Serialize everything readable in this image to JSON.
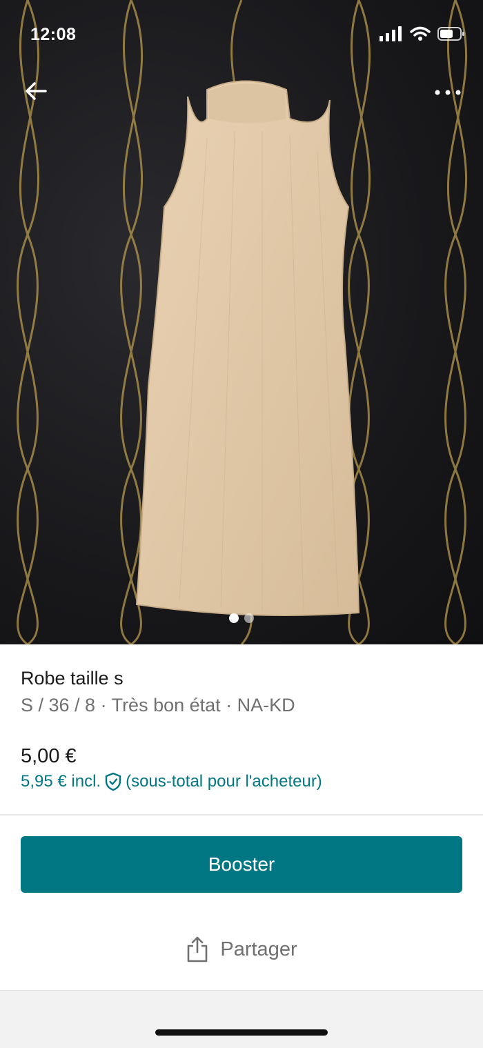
{
  "status_bar": {
    "time": "12:08"
  },
  "photo": {
    "current_index": 1,
    "total": 2
  },
  "item": {
    "title": "Robe taille s",
    "details": "S / 36 / 8 · Très bon état · NA-KD",
    "price": "5,00 €",
    "price_incl_amount": "5,95 € incl.",
    "price_incl_note": "(sous-total pour l'acheteur)"
  },
  "actions": {
    "booster_label": "Booster",
    "share_label": "Partager"
  },
  "colors": {
    "accent": "#007782",
    "text_primary": "#1a1a1a",
    "text_secondary": "#707070"
  },
  "icons": [
    "back-arrow-icon",
    "more-icon",
    "shield-check-icon",
    "share-icon",
    "signal-icon",
    "wifi-icon",
    "battery-icon"
  ]
}
